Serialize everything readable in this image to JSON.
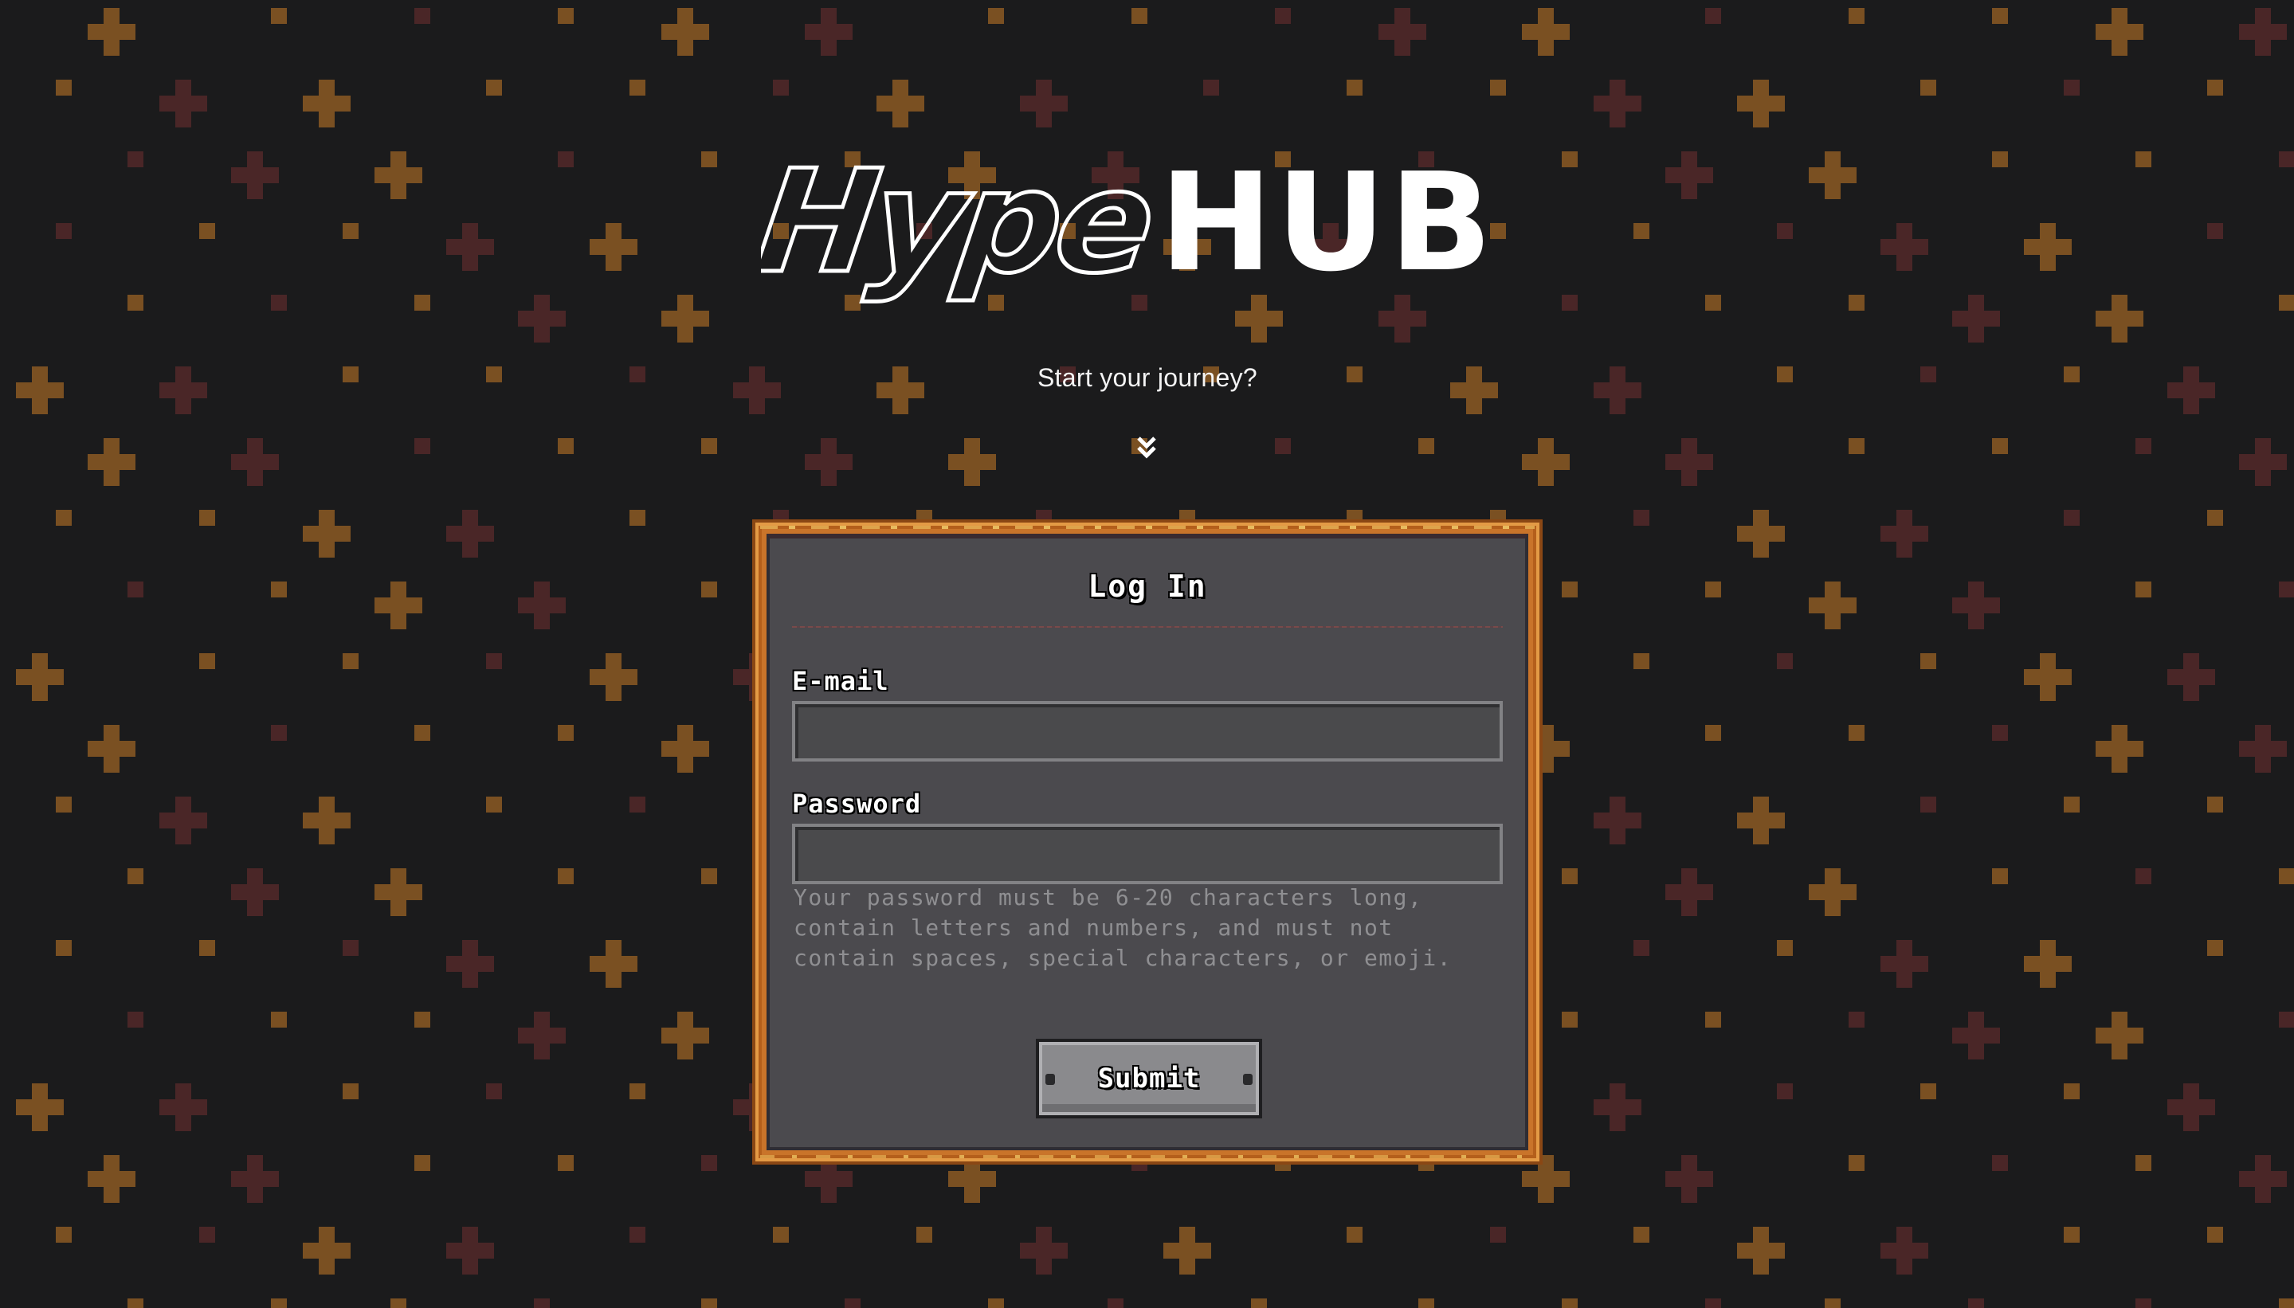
{
  "logo": {
    "outline_part": "Hype",
    "solid_part": "HUB"
  },
  "hero": {
    "tagline": "Start your journey?",
    "scroll_icon": "double-chevron-down-icon"
  },
  "login": {
    "title": "Log In",
    "email": {
      "label": "E-mail",
      "value": "",
      "placeholder": ""
    },
    "password": {
      "label": "Password",
      "value": "",
      "placeholder": "",
      "hint": "Your password must be 6-20 characters long, contain letters and numbers, and must not contain spaces, special characters, or emoji."
    },
    "submit_label": "Submit"
  },
  "colors": {
    "background": "#1b1b1c",
    "plus_gold": "#7a5022",
    "plus_maroon": "#4a2627",
    "frame_orange": "#c9742a",
    "panel": "#4b4a4e"
  }
}
